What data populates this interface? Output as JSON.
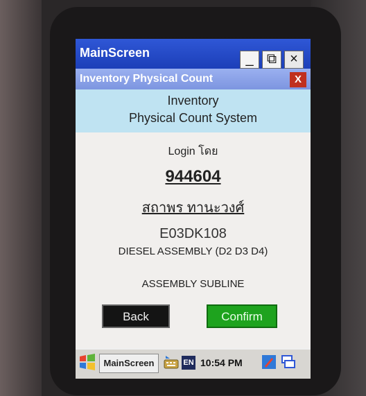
{
  "window": {
    "title": "MainScreen",
    "minimize_glyph": "_",
    "restore_glyph": "⧉",
    "close_glyph": "×"
  },
  "app": {
    "subtitle": "Inventory Physical Count",
    "close_glyph": "X",
    "header_line1": "Inventory",
    "header_line2": "Physical Count System"
  },
  "login": {
    "label": "Login โดย",
    "user_id": "944604",
    "user_name": "สถาพร ทานะวงศ์",
    "code": "E03DK108",
    "assembly": "DIESEL ASSEMBLY (D2 D3 D4)",
    "subline": "ASSEMBLY SUBLINE"
  },
  "buttons": {
    "back": "Back",
    "confirm": "Confirm"
  },
  "taskbar": {
    "task": "MainScreen",
    "lang": "EN",
    "time": "10:54 PM"
  },
  "colors": {
    "titlebar": "#1c3fb8",
    "header_band": "#bfe3f2",
    "confirm": "#1ea31e",
    "back": "#141414"
  },
  "icons": [
    "windows-start-icon",
    "keyboard-icon",
    "pen-icon",
    "taskswitch-icon"
  ]
}
